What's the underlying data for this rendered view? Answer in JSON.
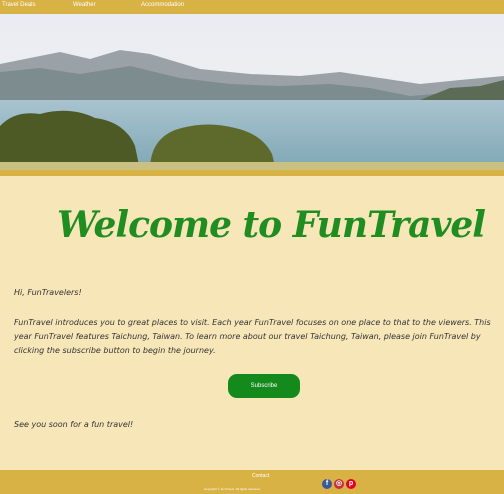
{
  "nav": {
    "links": [
      "Travel Deals",
      "Weather",
      "Accommodation"
    ]
  },
  "hero": {
    "image": "lake-mountain-landscape"
  },
  "main": {
    "title": "Welcome to FunTravel",
    "greeting": "Hi, FunTravelers!",
    "paragraph": "FunTravel introduces you to great places to visit. Each year FunTravel focuses on one place to that to the viewers. This year FunTravel features Taichung, Taiwan. To learn more about our travel Taichung, Taiwan, please join FunTravel by clicking the subscribe button to begin the journey.",
    "subscribe_label": "Subscribe",
    "closing": "See you soon for a fun travel!"
  },
  "footer": {
    "contact": "Contact",
    "copyright": "Copyright © FunTravel. All rights reserved.",
    "social_icons": [
      "facebook-icon",
      "instagram-icon",
      "pinterest-icon"
    ]
  },
  "colors": {
    "nav_bg": "#d9b245",
    "page_bg": "#f6e6b8",
    "title_green": "#1f8d1f",
    "button_green": "#138a1b"
  }
}
